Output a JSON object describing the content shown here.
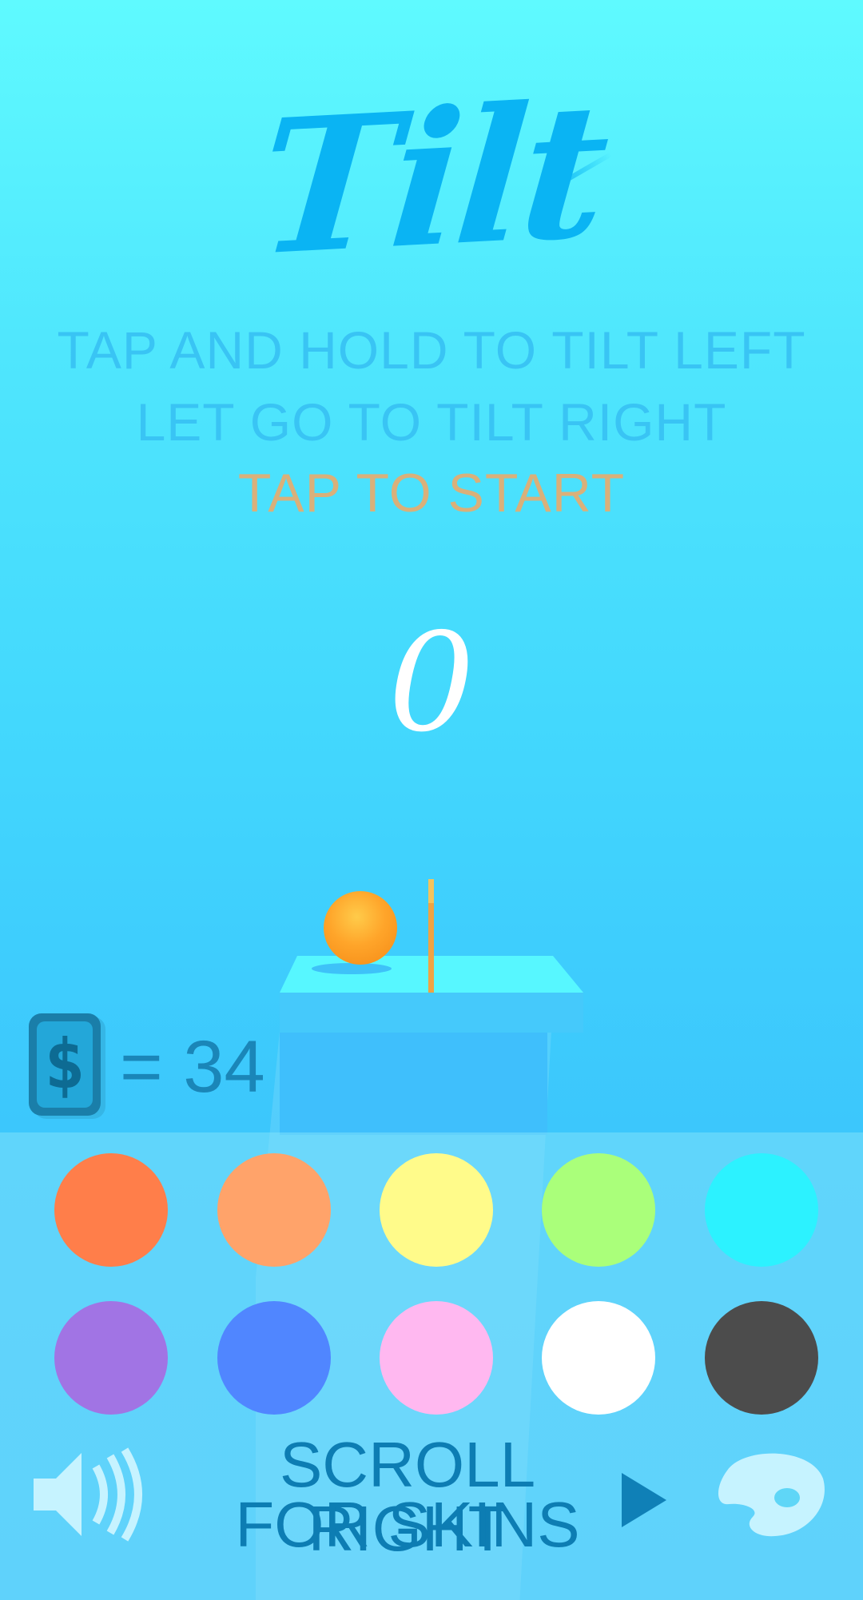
{
  "game": {
    "title": "Tilt",
    "instruction_1": "TAP AND HOLD TO TILT LEFT",
    "instruction_2": "LET GO TO TILT RIGHT",
    "start_prompt": "TAP TO START",
    "score": "0"
  },
  "coins": {
    "icon_symbol": "$",
    "label": "= 34"
  },
  "colors": {
    "accent": "#0ab4f3",
    "start_prompt": "#d9b07a",
    "ball": "#ffa52a"
  },
  "skins": {
    "swatches": [
      {
        "name": "orange-red",
        "color": "#ff7e4a"
      },
      {
        "name": "light-orange",
        "color": "#ffa36a"
      },
      {
        "name": "yellow",
        "color": "#fffb8a"
      },
      {
        "name": "green",
        "color": "#aaff7a"
      },
      {
        "name": "cyan",
        "color": "#2cf2ff"
      },
      {
        "name": "purple",
        "color": "#a174e4"
      },
      {
        "name": "blue",
        "color": "#5086ff"
      },
      {
        "name": "pink",
        "color": "#ffb8f0"
      },
      {
        "name": "white",
        "color": "#ffffff"
      },
      {
        "name": "dark-gray",
        "color": "#4c4c4c"
      }
    ]
  },
  "bottom_bar": {
    "scroll_line_1": "SCROLL RIGHT",
    "scroll_line_2": "FOR SKINS",
    "sound_icon": "speaker-icon",
    "next_icon": "play-arrow-icon",
    "palette_icon": "palette-icon"
  }
}
